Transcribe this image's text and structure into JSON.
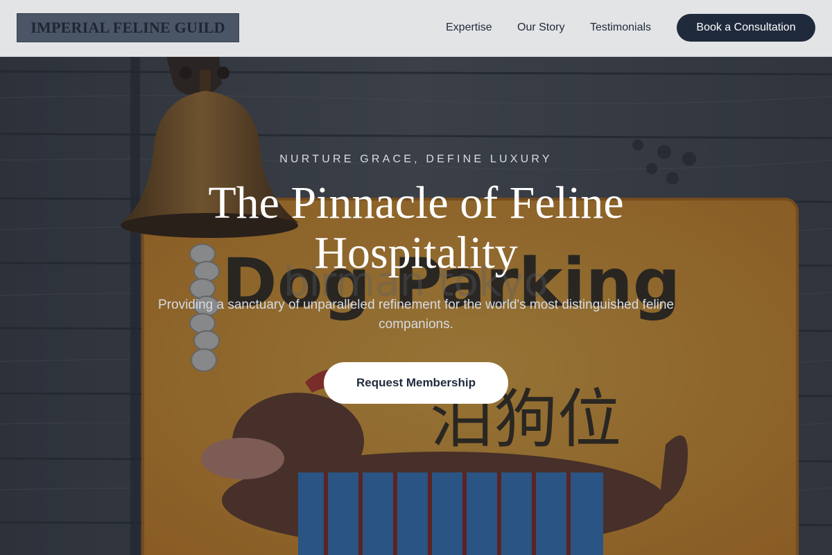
{
  "header": {
    "logo_text": "IMPERIAL FELINE GUILD",
    "nav": {
      "expertise": "Expertise",
      "our_story": "Our Story",
      "testimonials": "Testimonials"
    },
    "cta_label": "Book a Consultation"
  },
  "hero": {
    "eyebrow": "NURTURE GRACE, DEFINE LUXURY",
    "headline": "The Pinnacle of Feline Hospitality",
    "subtitle": "Providing a sanctuary of unparalleled refinement for the world's most distinguished feline companions.",
    "button_label": "Request Membership",
    "background_image": {
      "sign_text": "Dog Parking",
      "sign_chinese": "泊狗位",
      "watermark": "birman tokyo"
    }
  },
  "colors": {
    "header_bg": "#e3e4e6",
    "logo_bg": "#4a5566",
    "navy": "#1f2a3c",
    "sign_orange": "#e89a2c",
    "white": "#ffffff"
  }
}
